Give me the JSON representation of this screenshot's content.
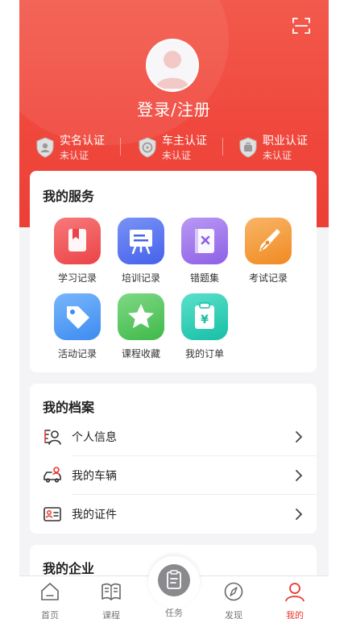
{
  "header": {
    "login_label": "登录/注册",
    "scan_icon": "scan-icon",
    "avatar_icon": "user-avatar-icon"
  },
  "certs": [
    {
      "title": "实名认证",
      "status": "未认证",
      "icon": "realname-badge-icon"
    },
    {
      "title": "车主认证",
      "status": "未认证",
      "icon": "car-owner-badge-icon"
    },
    {
      "title": "职业认证",
      "status": "未认证",
      "icon": "profession-badge-icon"
    }
  ],
  "services": {
    "title": "我的服务",
    "items": [
      {
        "label": "学习记录",
        "icon": "bookmark-book-icon",
        "color": "#f0565a"
      },
      {
        "label": "培训记录",
        "icon": "training-board-icon",
        "color": "#5874f0"
      },
      {
        "label": "错题集",
        "icon": "wrong-questions-book-icon",
        "color": "#a079ee"
      },
      {
        "label": "考试记录",
        "icon": "pen-nib-icon",
        "color": "#f59a3b"
      },
      {
        "label": "活动记录",
        "icon": "tag-icon",
        "color": "#4e9ff5"
      },
      {
        "label": "课程收藏",
        "icon": "star-icon",
        "color": "#5cc85f"
      },
      {
        "label": "我的订单",
        "icon": "order-clipboard-icon",
        "color": "#2fcfb8"
      }
    ]
  },
  "archive": {
    "title": "我的档案",
    "items": [
      {
        "label": "个人信息",
        "icon": "personal-info-icon"
      },
      {
        "label": "我的车辆",
        "icon": "vehicle-icon"
      },
      {
        "label": "我的证件",
        "icon": "id-card-icon"
      }
    ]
  },
  "enterprise": {
    "title": "我的企业"
  },
  "tabs": [
    {
      "label": "首页",
      "icon": "home-icon"
    },
    {
      "label": "课程",
      "icon": "book-icon"
    },
    {
      "label": "任务",
      "icon": "task-icon"
    },
    {
      "label": "发现",
      "icon": "compass-icon"
    },
    {
      "label": "我的",
      "icon": "profile-icon"
    }
  ],
  "colors": {
    "brand": "#f0483d",
    "active_tab": "#e8382f"
  }
}
